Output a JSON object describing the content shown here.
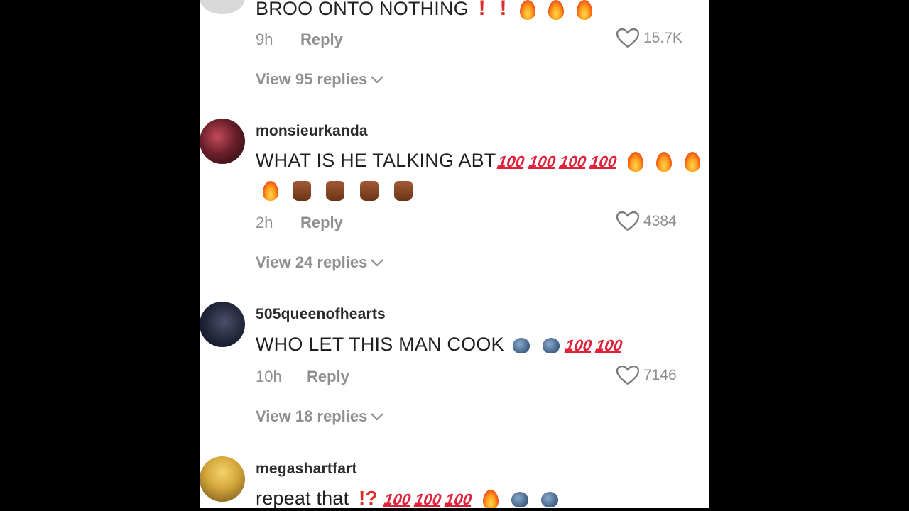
{
  "comments": [
    {
      "text": "BROO ONTO NOTHING",
      "emojis": [
        "exclamation",
        "exclamation",
        "fire",
        "fire",
        "fire"
      ],
      "time": "9h",
      "reply_label": "Reply",
      "likes": "15.7K",
      "view_replies": "View 95 replies"
    },
    {
      "username": "monsieurkanda",
      "text": "WHAT IS HE TALKING ABT",
      "emojis_line1": [
        "hundred",
        "hundred",
        "hundred",
        "hundred",
        "fire",
        "fire",
        "fire"
      ],
      "emojis_line2": [
        "fire",
        "thumb",
        "thumb",
        "thumb",
        "thumb"
      ],
      "time": "2h",
      "reply_label": "Reply",
      "likes": "4384",
      "view_replies": "View 24 replies"
    },
    {
      "username": "505queenofhearts",
      "text": "WHO LET THIS MAN COOK",
      "emojis": [
        "speaking-head",
        "speaking-head",
        "hundred",
        "hundred"
      ],
      "time": "10h",
      "reply_label": "Reply",
      "likes": "7146",
      "view_replies": "View 18 replies"
    },
    {
      "username": "megashartfart",
      "text": "repeat that",
      "emojis": [
        "interrobang",
        "hundred",
        "hundred",
        "hundred",
        "fire",
        "speaking-head",
        "speaking-head"
      ]
    }
  ],
  "emoji_text": {
    "hundred": "100",
    "exclamation": "!",
    "interrobang": "!?"
  },
  "colors": {
    "background": "#000000",
    "panel": "#ffffff",
    "text": "#1f1f1f",
    "meta": "#8f8f8f"
  }
}
